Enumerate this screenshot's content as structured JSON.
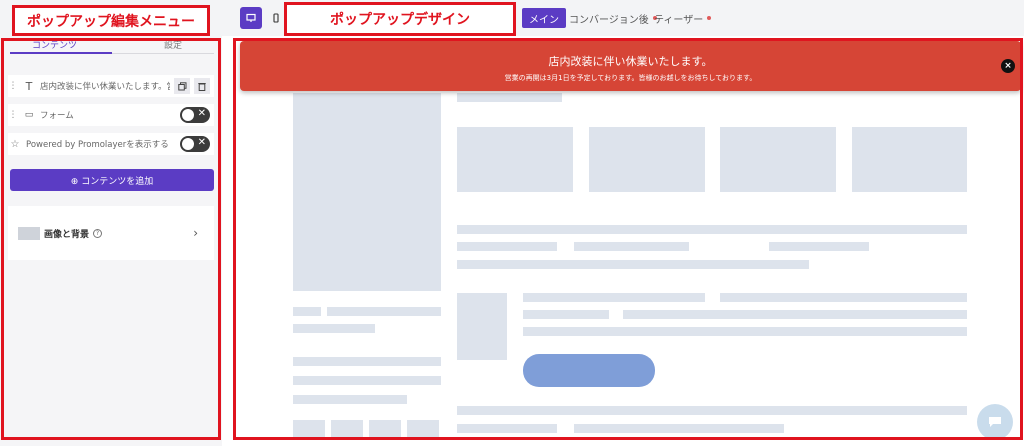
{
  "annotations": {
    "editor_menu": "ポップアップ編集メニュー",
    "design": "ポップアップデザイン"
  },
  "topbar": {
    "tabs": [
      {
        "label": "メイン"
      },
      {
        "label": "コンバージョン後"
      },
      {
        "label": "ティーザー"
      }
    ]
  },
  "panel": {
    "tabs": [
      "コンテンツ",
      "設定"
    ],
    "rows": [
      {
        "label": "店内改装に伴い休業いたします。営…"
      },
      {
        "label": "フォーム"
      },
      {
        "label": "Powered by Promolayerを表示する"
      }
    ],
    "add_button": "⊕ コンテンツを追加",
    "section": {
      "label": "画像と背景",
      "help": "?",
      "chevron": "›"
    }
  },
  "banner": {
    "title": "店内改装に伴い休業いたします。",
    "subtitle": "営業の再開は3月1日を予定しております。皆様のお越しをお待ちしております。",
    "close": "×"
  },
  "colors": {
    "accent": "#5b3cc4",
    "banner": "#d64536",
    "annotation": "#e0141f",
    "skeleton": "#dde3ec",
    "cta": "#7f9ed8",
    "chat": "#c9dcec"
  }
}
